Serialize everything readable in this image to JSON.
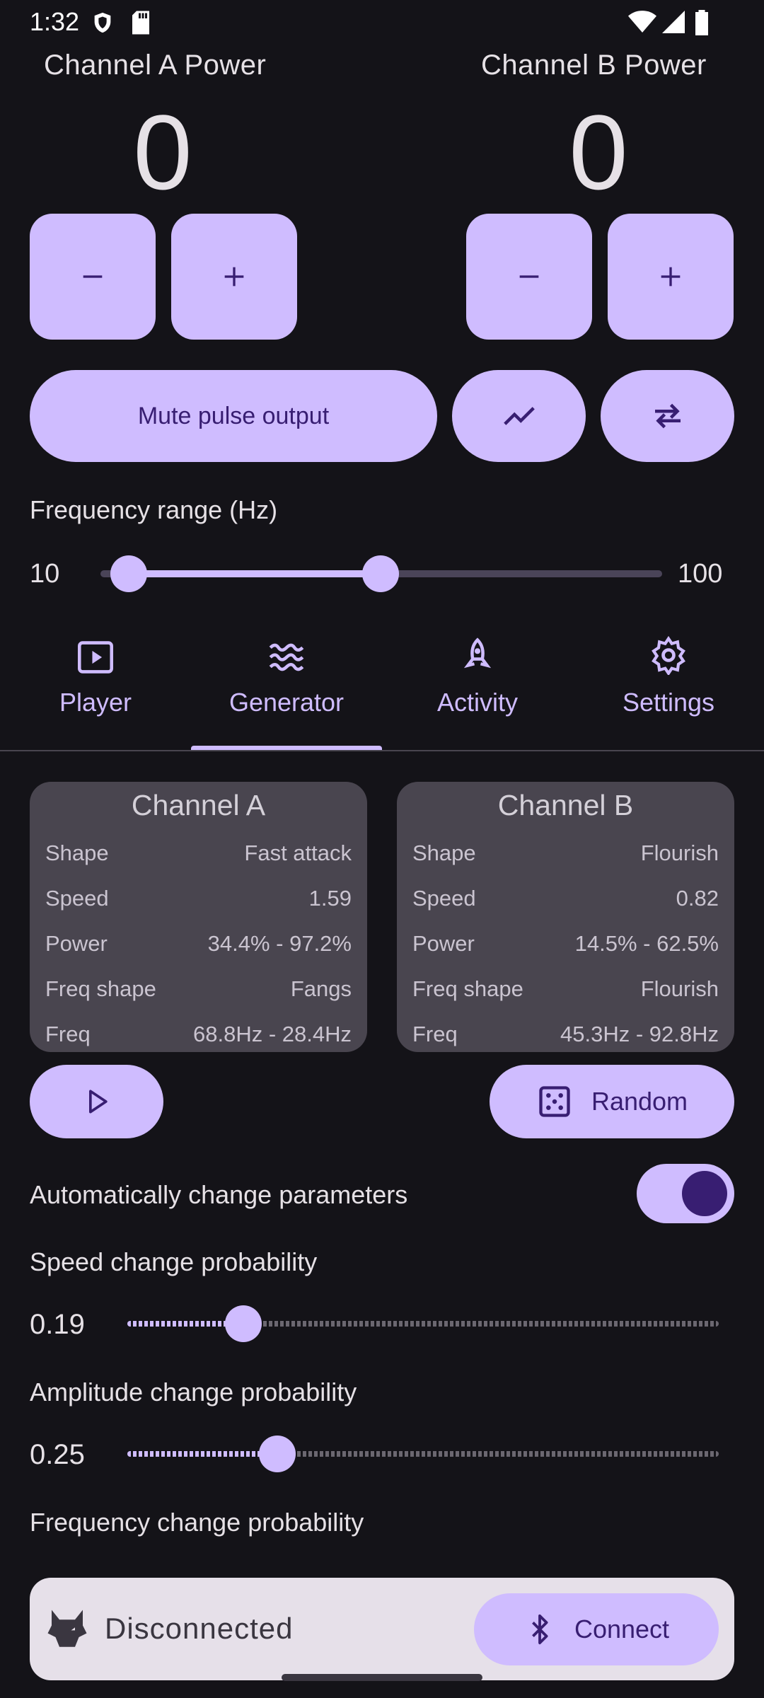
{
  "status_bar": {
    "time": "1:32"
  },
  "power": {
    "channel_a": {
      "title": "Channel A Power",
      "value": "0"
    },
    "channel_b": {
      "title": "Channel B Power",
      "value": "0"
    }
  },
  "controls": {
    "mute_label": "Mute pulse output"
  },
  "frequency_range": {
    "label": "Frequency range (Hz)",
    "min": "10",
    "max": "100"
  },
  "tabs": [
    {
      "label": "Player",
      "icon": "play-box-icon"
    },
    {
      "label": "Generator",
      "icon": "waves-icon"
    },
    {
      "label": "Activity",
      "icon": "rocket-icon"
    },
    {
      "label": "Settings",
      "icon": "gear-icon"
    }
  ],
  "cards": {
    "a": {
      "title": "Channel A",
      "rows": [
        {
          "k": "Shape",
          "v": "Fast attack"
        },
        {
          "k": "Speed",
          "v": "1.59"
        },
        {
          "k": "Power",
          "v": "34.4% - 97.2%"
        },
        {
          "k": "Freq shape",
          "v": "Fangs"
        },
        {
          "k": "Freq",
          "v": "68.8Hz - 28.4Hz"
        }
      ]
    },
    "b": {
      "title": "Channel B",
      "rows": [
        {
          "k": "Shape",
          "v": "Flourish"
        },
        {
          "k": "Speed",
          "v": "0.82"
        },
        {
          "k": "Power",
          "v": "14.5% - 62.5%"
        },
        {
          "k": "Freq shape",
          "v": "Flourish"
        },
        {
          "k": "Freq",
          "v": "45.3Hz - 92.8Hz"
        }
      ]
    }
  },
  "generator": {
    "random_label": "Random",
    "auto_change_label": "Automatically change parameters",
    "auto_change_enabled": true,
    "speed_prob": {
      "label": "Speed change probability",
      "value": "0.19"
    },
    "amp_prob": {
      "label": "Amplitude change probability",
      "value": "0.25"
    },
    "freq_prob": {
      "label": "Frequency change probability"
    }
  },
  "connection": {
    "status": "Disconnected",
    "connect_label": "Connect"
  },
  "colors": {
    "accent": "#cfbcff",
    "on_accent": "#381e72",
    "background": "#141318",
    "card": "#49454f"
  }
}
